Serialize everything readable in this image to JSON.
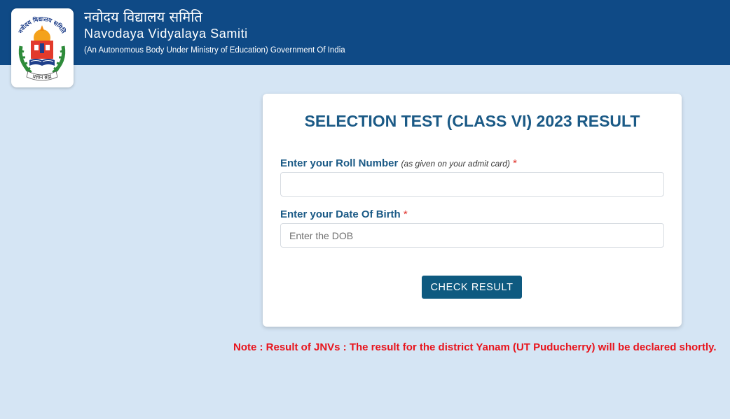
{
  "header": {
    "org_name_hindi": "नवोदय विद्यालय समिति",
    "org_name_english": "Navodaya Vidyalaya Samiti",
    "org_subtitle": "(An Autonomous Body Under Ministry of Education) Government Of India",
    "logo_text_top": "नवोदय विद्यालय समिति",
    "logo_text_bottom": "प्रज्ञानं ब्रह्म"
  },
  "form": {
    "title": "SELECTION TEST (CLASS VI) 2023 RESULT",
    "roll_label": "Enter your Roll Number",
    "roll_hint": "(as given on your admit card)",
    "roll_value": "",
    "dob_label": "Enter your Date Of Birth",
    "dob_placeholder": "Enter the DOB",
    "required_mark": "*",
    "submit_label": "CHECK RESULT"
  },
  "note": "Note : Result of JNVs : The result for the district Yanam (UT Puducherry) will be declared shortly.",
  "colors": {
    "header_bg": "#0f4a86",
    "page_bg": "#d5e5f4",
    "title": "#1b5a86",
    "button": "#0e5a80",
    "note": "#e8141c"
  }
}
